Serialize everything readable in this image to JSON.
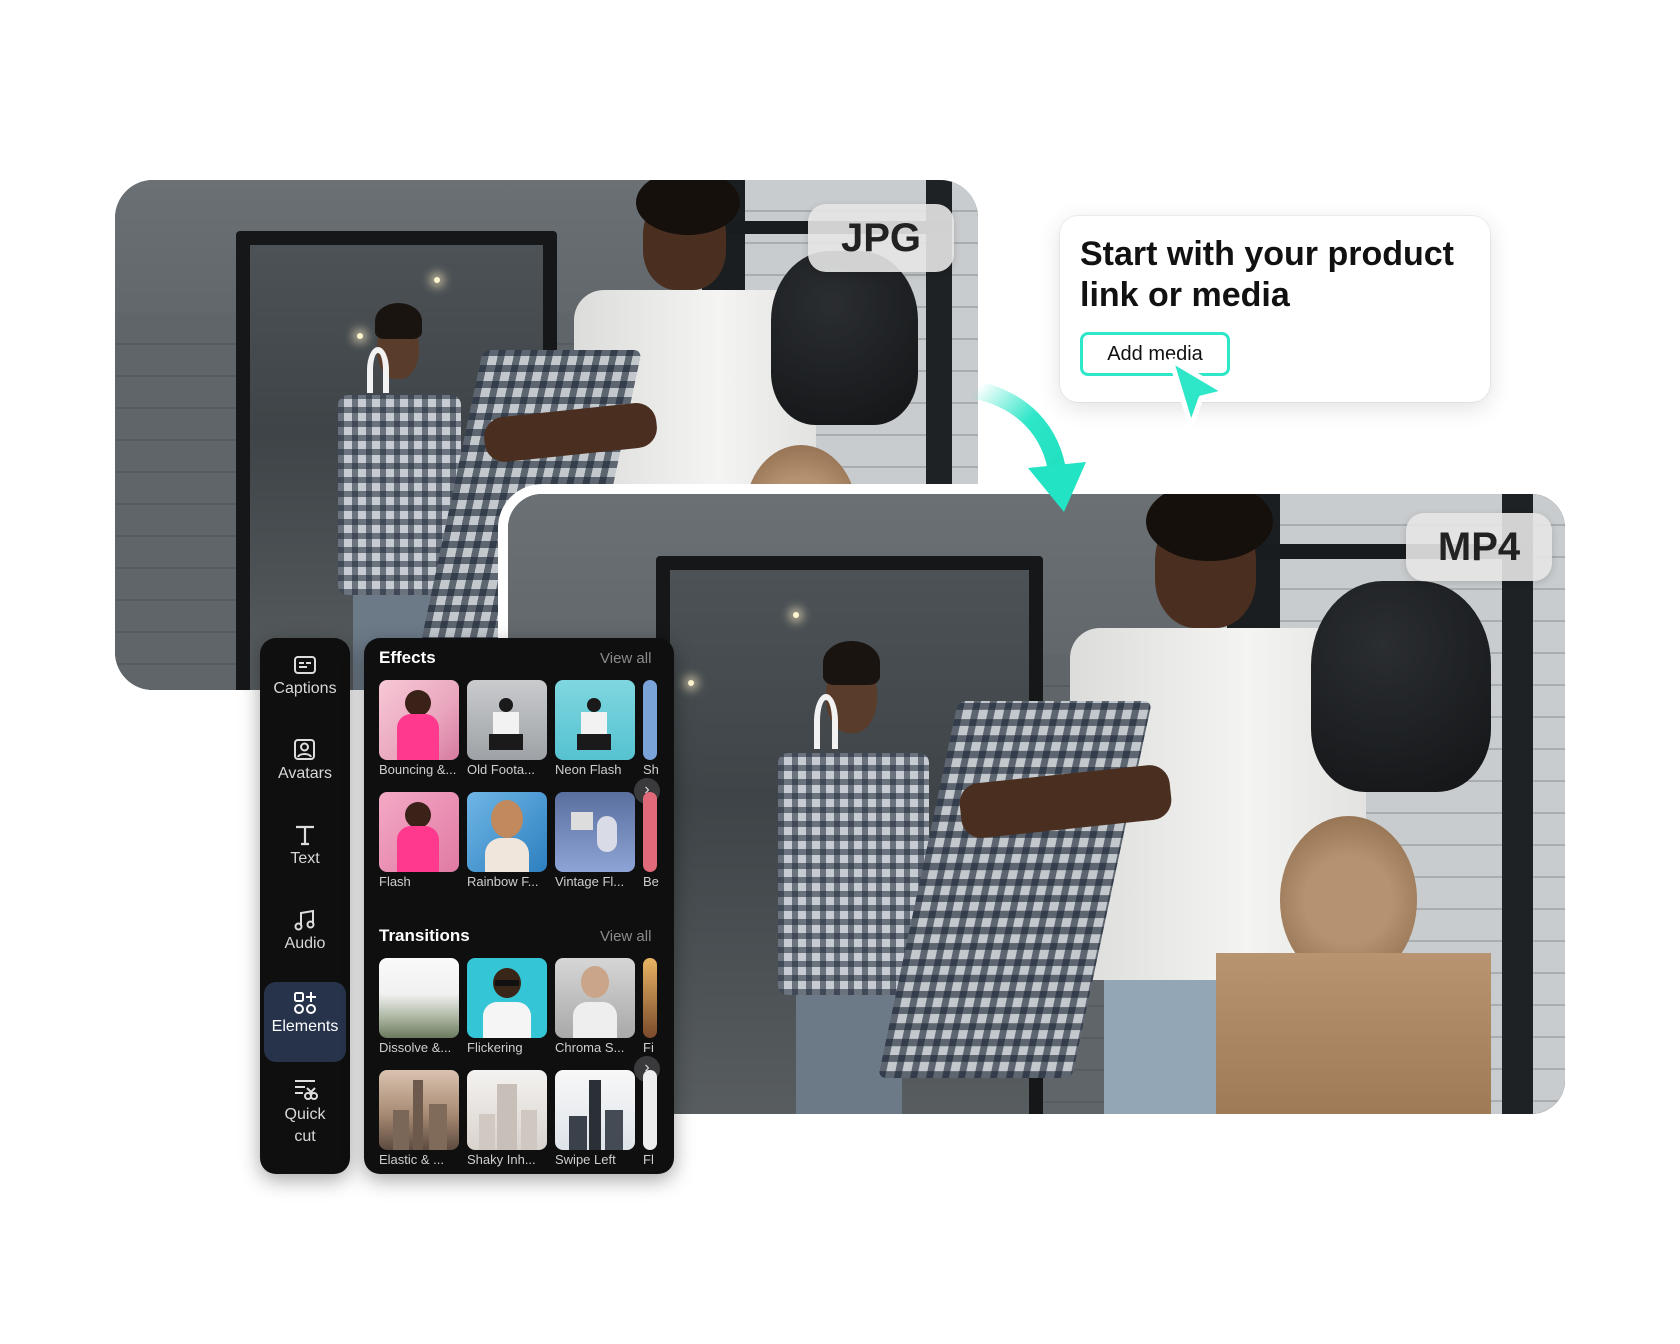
{
  "hero": {
    "jpg_badge": "JPG",
    "mp4_badge": "MP4"
  },
  "start_card": {
    "title": "Start with your product link or media",
    "button_label": "Add media"
  },
  "colors": {
    "accent": "#2ee6c8",
    "panel_bg": "#0f0f10",
    "active_item_bg": "#26334a"
  },
  "sidebar": {
    "items": [
      {
        "label": "Captions",
        "icon": "captions-icon"
      },
      {
        "label": "Avatars",
        "icon": "avatar-icon"
      },
      {
        "label": "Text",
        "icon": "text-icon"
      },
      {
        "label": "Audio",
        "icon": "music-note-icon"
      },
      {
        "label": "Elements",
        "icon": "elements-icon",
        "active": true
      },
      {
        "label": "Quick cut",
        "icon": "quick-cut-icon"
      }
    ]
  },
  "panel": {
    "effects": {
      "title": "Effects",
      "view_all": "View all",
      "items": [
        "Bouncing &...",
        "Old Foota...",
        "Neon Flash",
        "Sh",
        "Flash",
        "Rainbow F...",
        "Vintage Fl...",
        "Be"
      ]
    },
    "transitions": {
      "title": "Transitions",
      "view_all": "View all",
      "items": [
        "Dissolve &...",
        "Flickering",
        "Chroma S...",
        "Fi",
        "Elastic & ...",
        "Shaky Inh...",
        "Swipe Left",
        "Fl"
      ]
    }
  }
}
